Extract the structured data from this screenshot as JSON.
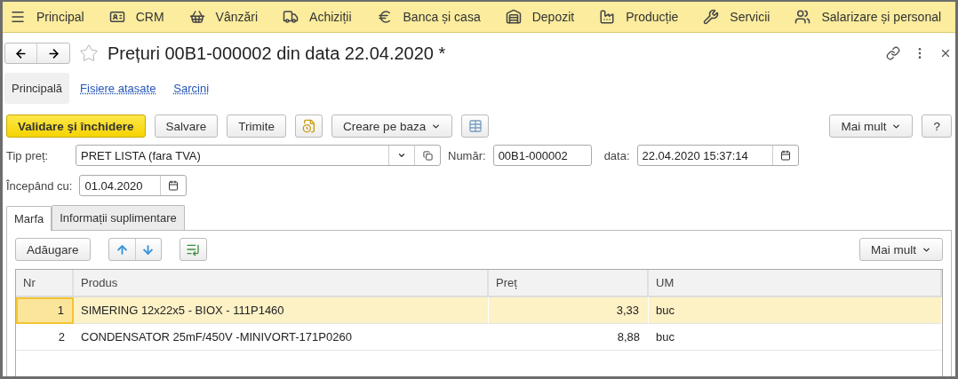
{
  "nav": [
    {
      "kind": "menu",
      "label": "Principal"
    },
    {
      "kind": "crm",
      "label": "CRM"
    },
    {
      "kind": "sales",
      "label": "Vânzări"
    },
    {
      "kind": "purchases",
      "label": "Achiziții"
    },
    {
      "kind": "bank",
      "label": "Banca și casa"
    },
    {
      "kind": "warehouse",
      "label": "Depozit"
    },
    {
      "kind": "production",
      "label": "Producție"
    },
    {
      "kind": "services",
      "label": "Servicii"
    },
    {
      "kind": "staff",
      "label": "Salarizare și personal"
    }
  ],
  "document": {
    "title": "Prețuri 00B1-000002 din data 22.04.2020 *",
    "favorite": false
  },
  "form_tabs": [
    {
      "label": "Principală",
      "selected": true
    },
    {
      "label": "Fisiere atasate",
      "selected": false
    },
    {
      "label": "Sarcini",
      "selected": false
    }
  ],
  "toolbar": [
    {
      "kind": "primary",
      "label": "Validare şi închidere"
    },
    {
      "kind": "plain",
      "label": "Salvare"
    },
    {
      "kind": "plain",
      "label": "Trimite"
    },
    {
      "kind": "report"
    },
    {
      "kind": "dropdown",
      "label": "Creare pe baza"
    },
    {
      "kind": "table"
    }
  ],
  "toolbar_right": [
    {
      "kind": "dropdown",
      "label": "Mai mult"
    },
    {
      "kind": "plain",
      "label": "?"
    }
  ],
  "fields": {
    "price_type": {
      "label": "Tip preț:",
      "value": "PRET LISTA (fara TVA)"
    },
    "number": {
      "label": "Număr:",
      "value": "00B1-000002"
    },
    "date": {
      "label": "data:",
      "value": "22.04.2020 15:37:14"
    },
    "start": {
      "label": "Începând cu:",
      "value": "01.04.2020"
    }
  },
  "tabs": [
    {
      "label": "Marfa",
      "selected": true
    },
    {
      "label": "Informații suplimentare",
      "selected": false
    }
  ],
  "table_toolbar": {
    "add": "Adăugare",
    "more": "Mai mult"
  },
  "table": {
    "columns": [
      "Nr",
      "Produs",
      "Preț",
      "UM"
    ],
    "rows": [
      {
        "cells": [
          "1",
          "SIMERING 12x22x5 - BIOX - 111P1460",
          "3,33",
          "buc"
        ],
        "selected": true
      },
      {
        "cells": [
          "2",
          "CONDENSATOR 25mF/450V -MINIVORT-171P0260",
          "8,88",
          "buc"
        ],
        "selected": false
      }
    ]
  }
}
